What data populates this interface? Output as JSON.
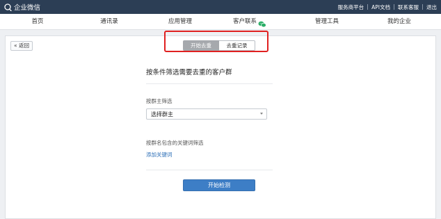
{
  "app": {
    "name": "企业微信"
  },
  "toplinks": [
    "服务商平台",
    "API文档",
    "联系客服",
    "退出"
  ],
  "nav": {
    "items": [
      {
        "label": "首页"
      },
      {
        "label": "通讯录"
      },
      {
        "label": "应用管理"
      },
      {
        "label": "客户联系",
        "icon": "wechat-icon"
      },
      {
        "label": "管理工具"
      },
      {
        "label": "我的企业"
      }
    ]
  },
  "back": {
    "label": "« 返回"
  },
  "tabs": [
    {
      "label": "开始去重",
      "active": true
    },
    {
      "label": "去重记录",
      "active": false
    }
  ],
  "form": {
    "title": "按条件筛选需要去重的客户群",
    "owner_label": "按群主筛选",
    "owner_select_value": "选择群主",
    "keyword_label": "按群名包含的关键词筛选",
    "add_keyword_link": "添加关键词",
    "submit_label": "开始检测"
  },
  "colors": {
    "topbar": "#2c3e55",
    "primary_button": "#3d7ec6",
    "link": "#2d6fb7",
    "highlight": "#e02020",
    "active_tab": "#a6a9ad",
    "wechat_green": "#2aae67"
  }
}
